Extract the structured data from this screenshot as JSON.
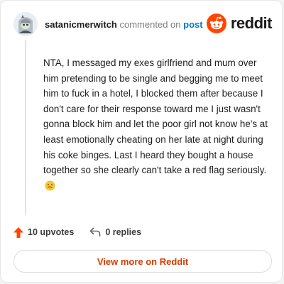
{
  "comment": {
    "username": "satanicmerwitch",
    "commented_on": "commented on",
    "post_link": "post",
    "body": "NTA, I messaged my exes girlfriend and mum over him pretending to be single and begging me to meet him to fuck in a hotel, I blocked them after because I don't care for their response toward me I just wasn't gonna block him and let the poor girl not know he's at least emotionally cheating on her late at night during his coke binges. Last I heard they bought a house together so she clearly can't take a red flag seriously.",
    "emoji_icon": "grimace-smile-emoji-icon"
  },
  "brand": {
    "logo_text": "reddit",
    "accent": "#ff4500"
  },
  "actions": {
    "upvotes": "10 upvotes",
    "replies": "0 replies"
  },
  "footer": {
    "view_more": "View more on Reddit"
  },
  "colors": {
    "link": "#0079d3",
    "view_more": "#d93a00",
    "upvote": "#ff4500"
  }
}
